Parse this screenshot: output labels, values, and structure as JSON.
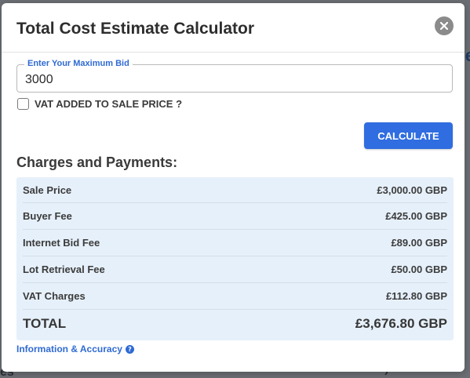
{
  "modal": {
    "title": "Total Cost Estimate Calculator",
    "close_icon": "close-icon"
  },
  "bid": {
    "legend": "Enter Your Maximum Bid",
    "value": "3000"
  },
  "vat": {
    "label": "VAT ADDED TO SALE PRICE ?",
    "checked": false
  },
  "calculate_label": "CALCULATE",
  "charges": {
    "heading": "Charges and Payments:",
    "rows": [
      {
        "label": "Sale Price",
        "value": "£3,000.00 GBP"
      },
      {
        "label": "Buyer Fee",
        "value": "£425.00 GBP"
      },
      {
        "label": "Internet Bid Fee",
        "value": "£89.00 GBP"
      },
      {
        "label": "Lot Retrieval Fee",
        "value": "£50.00 GBP"
      },
      {
        "label": "VAT Charges",
        "value": "£112.80 GBP"
      }
    ],
    "total": {
      "label": "TOTAL",
      "value": "£3,676.80 GBP"
    }
  },
  "info_link": {
    "label": "Information & Accuracy",
    "icon": "question-circle-icon"
  },
  "colors": {
    "accent": "#2f6de1",
    "table_bg": "#e6f0fa",
    "close_bg": "#8b8b8b"
  }
}
